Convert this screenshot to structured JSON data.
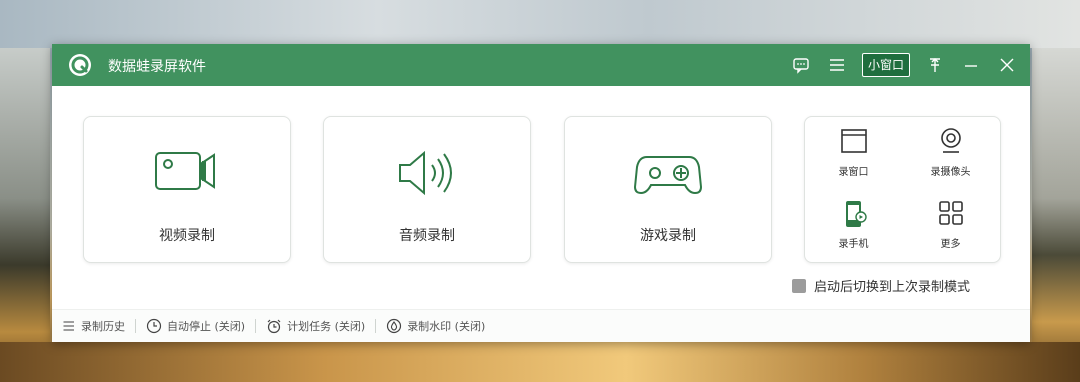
{
  "window": {
    "title": "数据蛙录屏软件",
    "mini_window_label": "小窗口"
  },
  "cards": [
    {
      "label": "视频录制",
      "icon": "video-camera-icon"
    },
    {
      "label": "音频录制",
      "icon": "speaker-icon"
    },
    {
      "label": "游戏录制",
      "icon": "gamepad-icon"
    }
  ],
  "grid": [
    {
      "label": "录窗口",
      "icon": "window-icon"
    },
    {
      "label": "录摄像头",
      "icon": "webcam-icon"
    },
    {
      "label": "录手机",
      "icon": "phone-icon"
    },
    {
      "label": "更多",
      "icon": "grid-icon"
    }
  ],
  "auto_mode_label": "启动后切换到上次录制模式",
  "footer": {
    "history": "录制历史",
    "auto_stop": "自动停止 (关闭)",
    "schedule": "计划任务 (关闭)",
    "watermark": "录制水印 (关闭)"
  },
  "colors": {
    "titlebar": "#41925f",
    "accent": "#2f7a47"
  }
}
